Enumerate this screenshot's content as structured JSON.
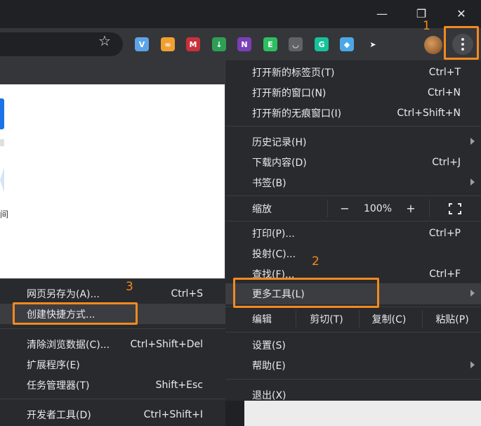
{
  "window": {
    "minimize_glyph": "—",
    "restore_glyph": "❐",
    "close_glyph": "✕"
  },
  "toolbar": {
    "extensions": [
      {
        "name": "vivaldi-ext-icon",
        "color": "#5da3e8",
        "glyph": "V"
      },
      {
        "name": "infinity-ext-icon",
        "color": "#f0a030",
        "glyph": "∞"
      },
      {
        "name": "mendeley-ext-icon",
        "color": "#c8303a",
        "glyph": "M"
      },
      {
        "name": "bookmark-pin-ext-icon",
        "color": "#2e9e55",
        "glyph": "↓"
      },
      {
        "name": "onenote-ext-icon",
        "color": "#7a3fb8",
        "glyph": "N"
      },
      {
        "name": "evernote-ext-icon",
        "color": "#2dbe60",
        "glyph": "E"
      },
      {
        "name": "pocket-ext-icon",
        "color": "#5f6368",
        "glyph": "◡"
      },
      {
        "name": "grammarly-ext-icon",
        "color": "#15c39a",
        "glyph": "G"
      },
      {
        "name": "diamond-ext-icon",
        "color": "#4aa8e8",
        "glyph": "◆"
      },
      {
        "name": "cursor-ext-icon",
        "color": "#35363a",
        "glyph": "➤"
      }
    ]
  },
  "page": {
    "side_char": "间"
  },
  "menu": {
    "new_tab": {
      "label": "打开新的标签页(T)",
      "shortcut": "Ctrl+T"
    },
    "new_window": {
      "label": "打开新的窗口(N)",
      "shortcut": "Ctrl+N"
    },
    "new_incognito": {
      "label": "打开新的无痕窗口(I)",
      "shortcut": "Ctrl+Shift+N"
    },
    "history": {
      "label": "历史记录(H)"
    },
    "downloads": {
      "label": "下载内容(D)",
      "shortcut": "Ctrl+J"
    },
    "bookmarks": {
      "label": "书签(B)"
    },
    "zoom": {
      "label": "缩放",
      "minus": "−",
      "value": "100%",
      "plus": "+"
    },
    "print": {
      "label": "打印(P)...",
      "shortcut": "Ctrl+P"
    },
    "cast": {
      "label": "投射(C)..."
    },
    "find": {
      "label": "查找(F)...",
      "shortcut": "Ctrl+F"
    },
    "more_tools": {
      "label": "更多工具(L)"
    },
    "edit": {
      "label": "编辑",
      "cut": "剪切(T)",
      "copy": "复制(C)",
      "paste": "粘贴(P)"
    },
    "settings": {
      "label": "设置(S)"
    },
    "help": {
      "label": "帮助(E)"
    },
    "exit": {
      "label": "退出(X)"
    }
  },
  "submenu": {
    "save_page": {
      "label": "网页另存为(A)...",
      "shortcut": "Ctrl+S"
    },
    "create_shortcut": {
      "label": "创建快捷方式..."
    },
    "clear_data": {
      "label": "清除浏览数据(C)...",
      "shortcut": "Ctrl+Shift+Del"
    },
    "extensions": {
      "label": "扩展程序(E)"
    },
    "task_manager": {
      "label": "任务管理器(T)",
      "shortcut": "Shift+Esc"
    },
    "dev_tools": {
      "label": "开发者工具(D)",
      "shortcut": "Ctrl+Shift+I"
    }
  },
  "annotations": {
    "step1": "1",
    "step2": "2",
    "step3": "3",
    "color": "#f28a1f"
  }
}
